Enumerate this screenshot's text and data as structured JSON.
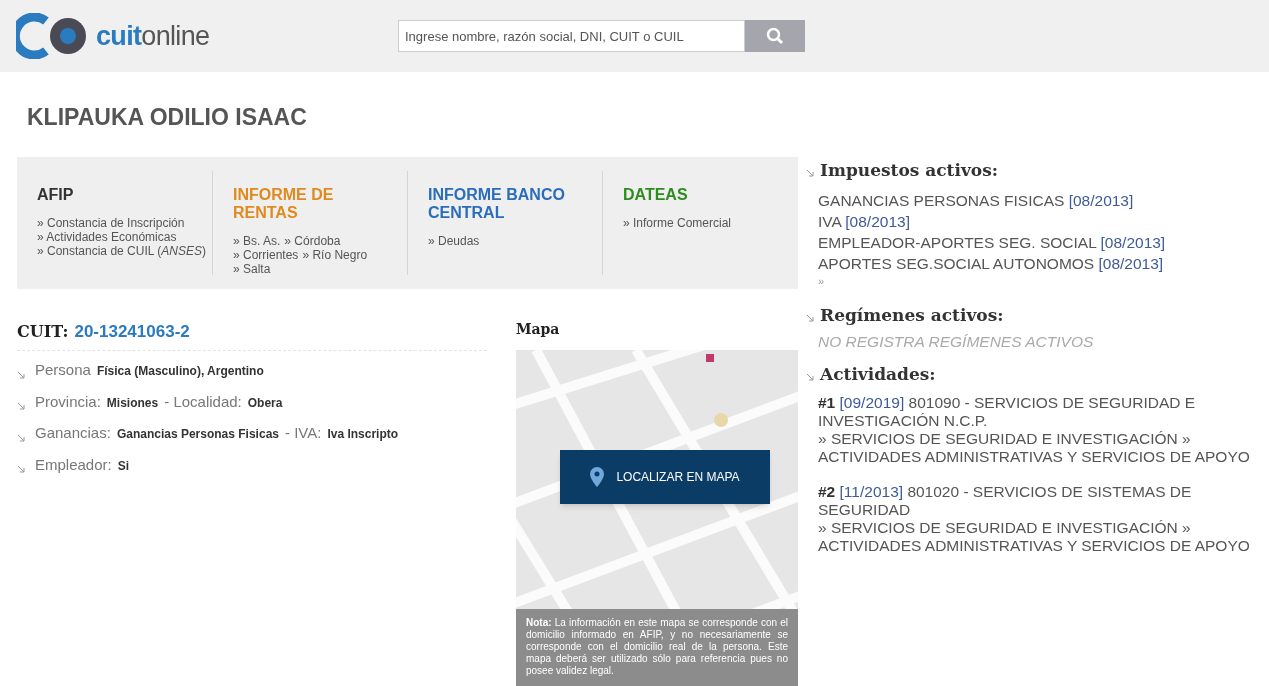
{
  "header": {
    "logo": {
      "part1": "cuit",
      "part2": "online"
    },
    "search": {
      "placeholder": "Ingrese nombre, razón social, DNI, CUIT o CUIL"
    }
  },
  "title": "KLIPAUKA ODILIO ISAAC",
  "reports": [
    {
      "title": "AFIP",
      "color": "#333333",
      "lines": [
        [
          "» Constancia de Inscripción"
        ],
        [
          "» Actividades Económicas"
        ],
        [
          "» Constancia de CUIL (*ANSES*)"
        ]
      ]
    },
    {
      "title": "INFORME DE RENTAS",
      "color": "#e08a1e",
      "lines": [
        [
          "» Bs. As.",
          "» Córdoba"
        ],
        [
          "» Corrientes",
          "» Río Negro"
        ],
        [
          "» Salta"
        ]
      ]
    },
    {
      "title": "INFORME BANCO CENTRAL",
      "color": "#2a6ebb",
      "lines": [
        [
          "» Deudas"
        ]
      ]
    },
    {
      "title": "DATEAS",
      "color": "#2e8b1e",
      "lines": [
        [
          "» Informe Comercial"
        ]
      ]
    }
  ],
  "cuit": {
    "label": "CUIT:",
    "value": "20-13241063-2"
  },
  "details": [
    [
      {
        "kind": "label",
        "text": "Persona"
      },
      {
        "kind": "value",
        "text": "Física (Masculino), Argentino"
      }
    ],
    [
      {
        "kind": "label",
        "text": "Provincia:"
      },
      {
        "kind": "value",
        "text": "Misiones"
      },
      {
        "kind": "label",
        "text": "- Localidad:"
      },
      {
        "kind": "value",
        "text": "Obera"
      }
    ],
    [
      {
        "kind": "label",
        "text": "Ganancias:"
      },
      {
        "kind": "value",
        "text": "Ganancias Personas Fisicas"
      },
      {
        "kind": "label",
        "text": "- IVA:"
      },
      {
        "kind": "value",
        "text": "Iva Inscripto"
      }
    ],
    [
      {
        "kind": "label",
        "text": "Empleador:"
      },
      {
        "kind": "value",
        "text": "Si"
      }
    ]
  ],
  "map": {
    "title": "Mapa",
    "button": "LOCALIZAR EN MAPA",
    "note": "**Nota:** La información en este mapa se corresponde con el domicilio informado en AFIP, y no necesariamente se corresponde con el domicilio real de la persona. Este mapa deberá ser utilizado sólo para referencia pues no posee validez legal."
  },
  "taxes": {
    "title": "Impuestos activos:",
    "items": [
      {
        "name": "GANANCIAS PERSONAS FISICAS",
        "date": "[08/2013]"
      },
      {
        "name": "IVA",
        "date": "[08/2013]"
      },
      {
        "name": "EMPLEADOR-APORTES SEG. SOCIAL",
        "date": "[08/2013]"
      },
      {
        "name": "APORTES SEG.SOCIAL AUTONOMOS",
        "date": "[08/2013]"
      }
    ],
    "more": "»"
  },
  "regimes": {
    "title": "Regímenes activos:",
    "empty": "NO REGISTRA REGÍMENES ACTIVOS"
  },
  "activities": {
    "title": "Actividades:",
    "items": [
      {
        "number": "#1",
        "date": "[09/2019]",
        "description": "801090 - SERVICIOS DE SEGURIDAD E INVESTIGACIÓN N.C.P.",
        "category": "» SERVICIOS DE SEGURIDAD E INVESTIGACIÓN » ACTIVIDADES ADMINISTRATIVAS Y SERVICIOS DE APOYO"
      },
      {
        "number": "#2",
        "date": "[11/2013]",
        "description": "801020 - SERVICIOS DE SISTEMAS DE SEGURIDAD",
        "category": "» SERVICIOS DE SEGURIDAD E INVESTIGACIÓN » ACTIVIDADES ADMINISTRATIVAS Y SERVICIOS DE APOYO"
      }
    ]
  }
}
